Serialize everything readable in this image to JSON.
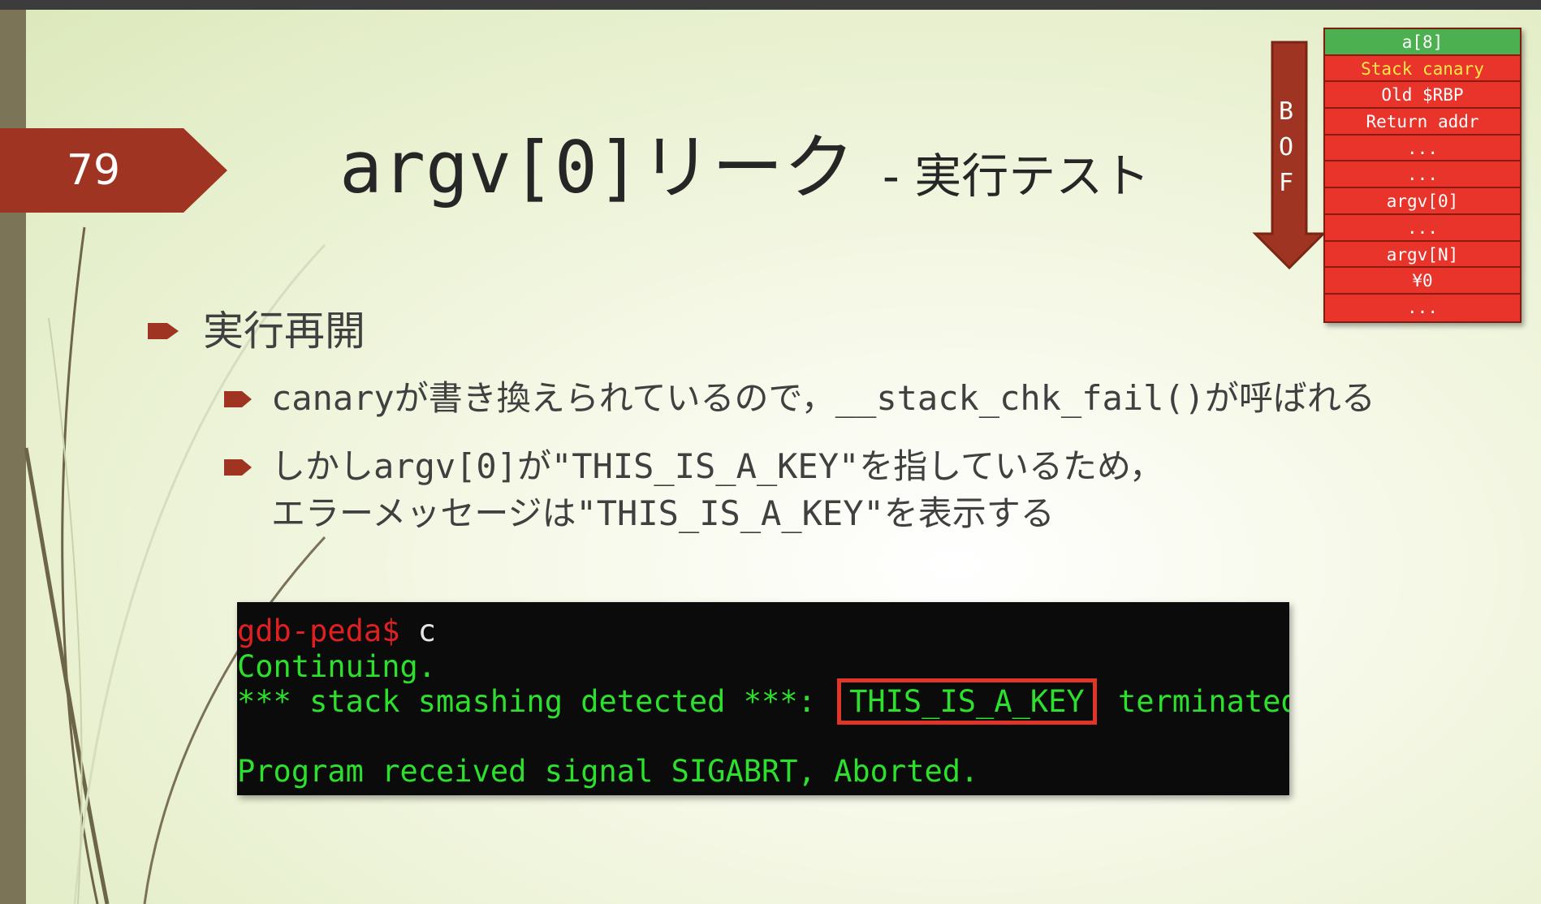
{
  "slide": {
    "number": "79",
    "title": "argv[0]リーク",
    "subtitle": "- 実行テスト"
  },
  "bof": {
    "letters": [
      "B",
      "O",
      "F"
    ]
  },
  "stack": {
    "rows": [
      "a[8]",
      "Stack canary",
      "Old $RBP",
      "Return addr",
      "...",
      "...",
      "argv[0]",
      "...",
      "argv[N]",
      "¥0",
      "..."
    ]
  },
  "bullets": {
    "main": "実行再開",
    "sub1": "canaryが書き換えられているので，__stack_chk_fail()が呼ばれる",
    "sub2_line1": "しかしargv[0]が\"THIS_IS_A_KEY\"を指しているため，",
    "sub2_line2": "エラーメッセージは\"THIS_IS_A_KEY\"を表示する"
  },
  "terminal": {
    "prompt": "gdb-peda$",
    "command": " c",
    "line2": "Continuing.",
    "line3_prefix": "*** stack smashing detected ***: ",
    "line3_key": "THIS_IS_A_KEY",
    "line3_suffix": " terminated",
    "line4": "Program received signal SIGABRT, Aborted."
  },
  "colors": {
    "accent_red": "#9e3421",
    "stack_red": "#e8342a",
    "stack_green": "#4caf50",
    "terminal_green": "#2de02d"
  }
}
